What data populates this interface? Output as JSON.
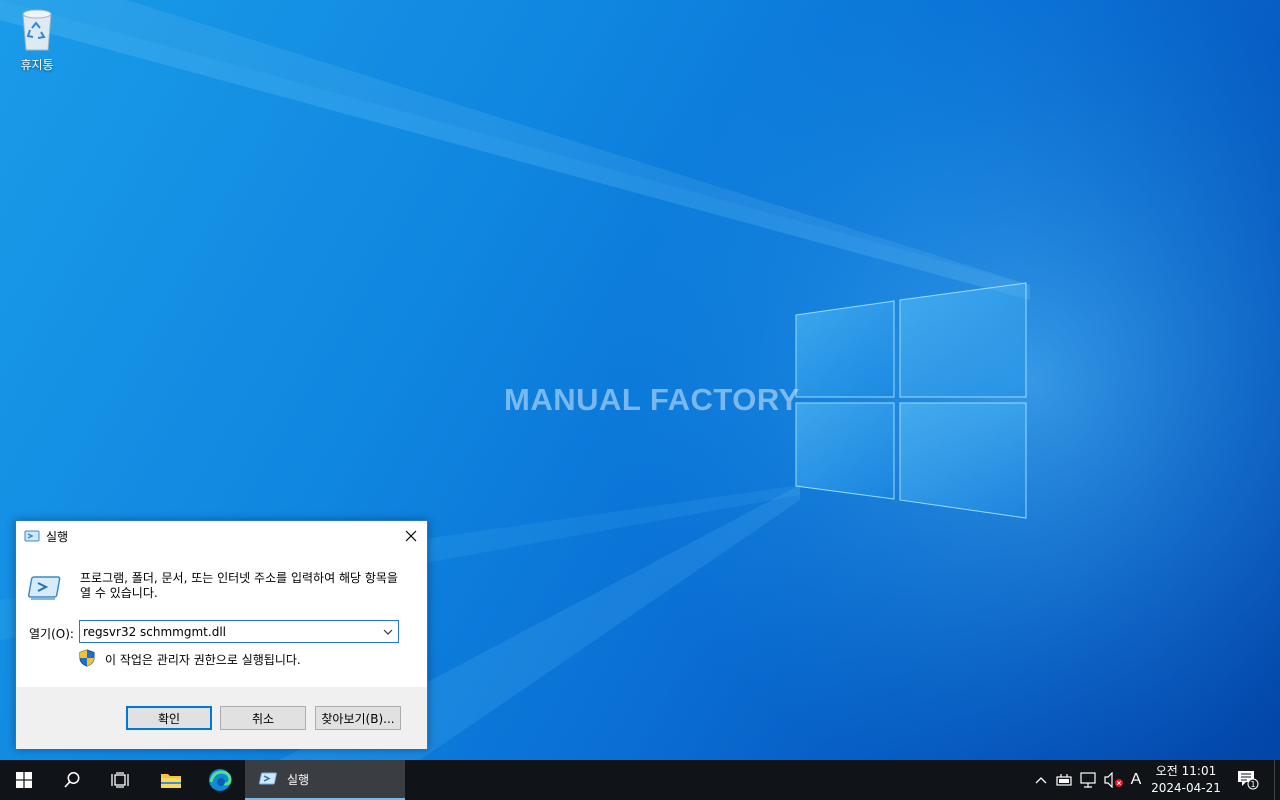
{
  "desktop": {
    "watermark": "MANUAL FACTORY",
    "icons": [
      {
        "label": "휴지통",
        "icon": "recycle-bin-icon"
      }
    ]
  },
  "run_dialog": {
    "title": "실행",
    "description": "프로그램, 폴더, 문서, 또는 인터넷 주소를 입력하여 해당 항목을 열 수 있습니다.",
    "open_label": "열기(O):",
    "command_value": "regsvr32 schmmgmt.dll",
    "admin_note": "이 작업은 관리자 권한으로 실행됩니다.",
    "buttons": {
      "ok": "확인",
      "cancel": "취소",
      "browse": "찾아보기(B)..."
    }
  },
  "taskbar": {
    "running_app_label": "실행",
    "ime_indicator": "A",
    "clock_time": "오전 11:01",
    "clock_date": "2024-04-21",
    "notification_count": "1"
  },
  "colors": {
    "accent": "#0078d7",
    "taskbar": "#101418",
    "dialog_footer": "#f0f0f0"
  }
}
